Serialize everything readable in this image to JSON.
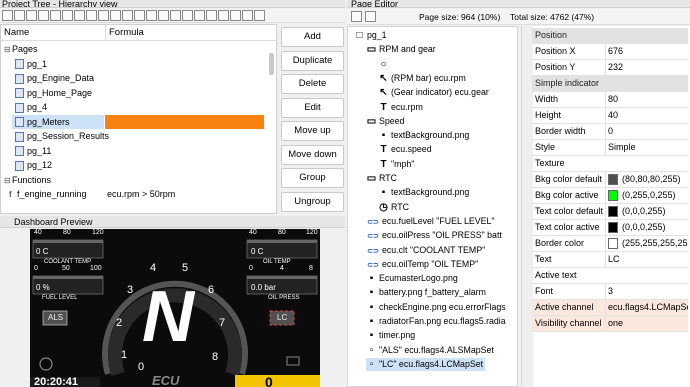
{
  "project_tree": {
    "title": "Project Tree - Hierarchy view",
    "columns": [
      "Name",
      "Formula"
    ],
    "rows": [
      {
        "name": "Pages",
        "formula": "",
        "type": "folder"
      },
      {
        "name": "pg_1",
        "formula": "",
        "type": "page"
      },
      {
        "name": "pg_Engine_Data",
        "formula": "",
        "type": "page"
      },
      {
        "name": "pg_Home_Page",
        "formula": "",
        "type": "page"
      },
      {
        "name": "pg_4",
        "formula": "",
        "type": "page"
      },
      {
        "name": "pg_Meters",
        "formula": "",
        "type": "page",
        "selected": true
      },
      {
        "name": "pg_Session_Results",
        "formula": "",
        "type": "page"
      },
      {
        "name": "pg_11",
        "formula": "",
        "type": "page"
      },
      {
        "name": "pg_12",
        "formula": "",
        "type": "page"
      },
      {
        "name": "Functions",
        "formula": "",
        "type": "folder"
      },
      {
        "name": "f_engine_running",
        "formula": "ecu.rpm > 50rpm",
        "type": "function"
      }
    ],
    "buttons": [
      "Add",
      "Duplicate",
      "Delete",
      "Edit",
      "Move up",
      "Move down",
      "Group",
      "Ungroup"
    ]
  },
  "dashboard_preview": {
    "title": "Dashboard Preview",
    "coolant": {
      "ticks": [
        "40",
        "80",
        "120"
      ],
      "value": "0 C",
      "label": "COOLANT TEMP"
    },
    "fuel": {
      "ticks": [
        "0",
        "50",
        "100"
      ],
      "value": "0 %",
      "label": "FUEL LEVEL"
    },
    "oiltemp": {
      "ticks": [
        "40",
        "80",
        "120"
      ],
      "value": "0 C",
      "label": "OIL TEMP"
    },
    "oilpress": {
      "ticks": [
        "0",
        "4",
        "8"
      ],
      "value": "0.0 bar",
      "label": "OIL PRESS"
    },
    "gear": "N",
    "rpm_ticks": [
      "1",
      "2",
      "3",
      "4",
      "5",
      "6",
      "7",
      "8",
      "0"
    ],
    "als": "ALS",
    "lc": "LC",
    "clock": "20:20:41",
    "speed": "0",
    "logo": "ECU"
  },
  "page_editor": {
    "title": "Page Editor",
    "page_size": "Page size: 964 (10%)",
    "total_size": "Total size: 4762 (47%)",
    "tree": [
      {
        "indent": 0,
        "glyph": "□",
        "text": "pg_1"
      },
      {
        "indent": 1,
        "glyph": "▭",
        "text": "RPM and gear"
      },
      {
        "indent": 2,
        "glyph": "○",
        "text": ""
      },
      {
        "indent": 2,
        "glyph": "↖",
        "text": "(RPM bar)    ecu.rpm"
      },
      {
        "indent": 2,
        "glyph": "↖",
        "text": "(Gear indicator)    ecu.gear"
      },
      {
        "indent": 2,
        "glyph": "T",
        "text": "ecu.rpm"
      },
      {
        "indent": 1,
        "glyph": "▭",
        "text": "Speed"
      },
      {
        "indent": 2,
        "glyph": "▪",
        "text": "textBackground.png"
      },
      {
        "indent": 2,
        "glyph": "T",
        "text": "ecu.speed"
      },
      {
        "indent": 2,
        "glyph": "T",
        "text": "\"mph\""
      },
      {
        "indent": 1,
        "glyph": "▭",
        "text": "RTC"
      },
      {
        "indent": 2,
        "glyph": "▪",
        "text": "textBackground.png"
      },
      {
        "indent": 2,
        "glyph": "◷",
        "text": "RTC"
      },
      {
        "indent": 1,
        "glyph": "⊂⊃",
        "text": "ecu.fuelLevel    \"FUEL LEVEL\""
      },
      {
        "indent": 1,
        "glyph": "⊂⊃",
        "text": "ecu.oilPress    \"OIL PRESS\"    batt"
      },
      {
        "indent": 1,
        "glyph": "⊂⊃",
        "text": "ecu.clt    \"COOLANT TEMP\""
      },
      {
        "indent": 1,
        "glyph": "⊂⊃",
        "text": "ecu.oilTemp    \"OIL TEMP\""
      },
      {
        "indent": 1,
        "glyph": "▪",
        "text": "EcumasterLogo.png"
      },
      {
        "indent": 1,
        "glyph": "▪",
        "text": "battery.png    f_battery_alarm"
      },
      {
        "indent": 1,
        "glyph": "▪",
        "text": "checkEngine.png    ecu.errorFlags"
      },
      {
        "indent": 1,
        "glyph": "▪",
        "text": "radiatorFan.png    ecu.flags5.radia"
      },
      {
        "indent": 1,
        "glyph": "▪",
        "text": "timer.png"
      },
      {
        "indent": 1,
        "glyph": "▫",
        "text": "\"ALS\"    ecu.flags4.ALSMapSet"
      },
      {
        "indent": 1,
        "glyph": "▫",
        "text": "\"LC\"    ecu.flags4.LCMapSet",
        "selected": true
      }
    ]
  },
  "properties": {
    "rows": [
      {
        "section": true,
        "key": "Position"
      },
      {
        "key": "Position X",
        "value": "676"
      },
      {
        "key": "Position Y",
        "value": "232"
      },
      {
        "section": true,
        "key": "Simple indicator"
      },
      {
        "key": "Width",
        "value": "80"
      },
      {
        "key": "Height",
        "value": "40"
      },
      {
        "key": "Border width",
        "value": "0"
      },
      {
        "key": "Style",
        "value": "Simple"
      },
      {
        "key": "Texture",
        "value": ""
      },
      {
        "key": "Bkg color default",
        "value": "(80,80,80,255)",
        "swatch": "#505050"
      },
      {
        "key": "Bkg color active",
        "value": "(0,255,0,255)",
        "swatch": "#00ff00"
      },
      {
        "key": "Text color default",
        "value": "(0,0,0,255)",
        "swatch": "#000000"
      },
      {
        "key": "Text color active",
        "value": "(0,0,0,255)",
        "swatch": "#000000"
      },
      {
        "key": "Border color",
        "value": "(255,255,255,255)",
        "swatch": "#ffffff"
      },
      {
        "key": "Text",
        "value": "LC"
      },
      {
        "key": "Active text",
        "value": ""
      },
      {
        "key": "Font",
        "value": "3"
      },
      {
        "key": "Active channel",
        "value": "ecu.flags4.LCMapSet",
        "highlight": true
      },
      {
        "key": "Visibility channel",
        "value": "one",
        "highlight": true
      }
    ]
  },
  "colors": {
    "selection": "#f7820f",
    "editor_selection": "#cde2f7",
    "highlight": "#fbe7dc",
    "dash_bg": "#0b0b0b"
  }
}
